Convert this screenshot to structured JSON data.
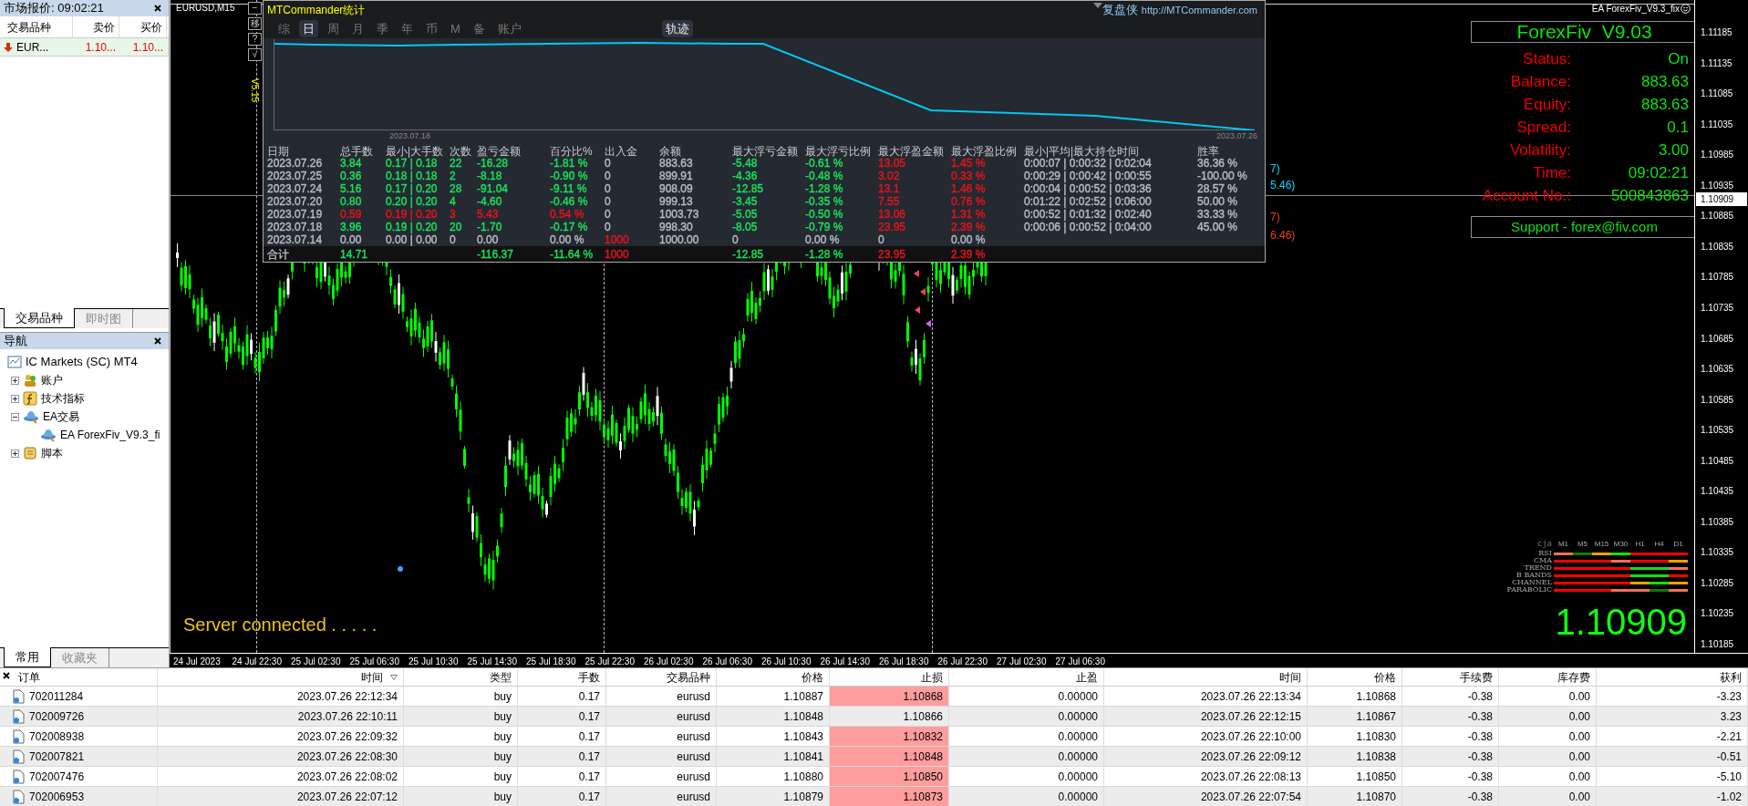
{
  "market_watch": {
    "title": "市场报价: 09:02:21",
    "columns": [
      "交易品种",
      "卖价",
      "买价"
    ],
    "rows": [
      {
        "symbol": "EUR...",
        "bid": "1.10...",
        "ask": "1.10..."
      }
    ],
    "tabs": [
      {
        "label": "交易品种",
        "selected": true
      },
      {
        "label": "即时图",
        "selected": false
      }
    ]
  },
  "navigator": {
    "title": "导航",
    "root": {
      "label": "IC Markets (SC) MT4",
      "children": [
        {
          "label": "账户",
          "kind": "accounts",
          "expanded": false
        },
        {
          "label": "技术指标",
          "kind": "indicators",
          "expanded": false
        },
        {
          "label": "EA交易",
          "kind": "experts",
          "expanded": true,
          "children": [
            {
              "label": "EA ForexFiv_V9.3_fi",
              "kind": "expert"
            }
          ]
        },
        {
          "label": "脚本",
          "kind": "scripts",
          "expanded": false
        }
      ]
    },
    "tabs": [
      {
        "label": "常用",
        "selected": true
      },
      {
        "label": "收藏夹",
        "selected": false
      }
    ]
  },
  "chart": {
    "title": "EURUSD,M15",
    "status": "Server connected . . . . .",
    "current_price": "1.10909",
    "price_labels": [
      "1.11185",
      "1.11135",
      "1.11085",
      "1.11035",
      "1.10985",
      "1.10935",
      "1.10885",
      "1.10835",
      "1.10785",
      "1.10735",
      "1.10685",
      "1.10635",
      "1.10585",
      "1.10535",
      "1.10485",
      "1.10435",
      "1.10385",
      "1.10335",
      "1.10285",
      "1.10235",
      "1.10185"
    ],
    "time_labels": [
      "24 Jul 2023",
      "24 Jul 22:30",
      "25 Jul 02:30",
      "25 Jul 06:30",
      "25 Jul 10:30",
      "25 Jul 14:30",
      "25 Jul 18:30",
      "25 Jul 22:30",
      "26 Jul 02:30",
      "26 Jul 06:30",
      "26 Jul 10:30",
      "26 Jul 14:30",
      "26 Jul 18:30",
      "26 Jul 22:30",
      "27 Jul 02:30",
      "27 Jul 06:30"
    ],
    "line_labels": [
      {
        "text": "7)",
        "color": "#00d8ff"
      },
      {
        "text": "5.46)",
        "color": "#00d8ff"
      },
      {
        "text": "7)",
        "color": "#e8401a"
      },
      {
        "text": "6.46)",
        "color": "#e8401a"
      }
    ]
  },
  "stats_panel": {
    "tool_buttons": [
      "−",
      "移",
      "?",
      "√"
    ],
    "version": "V5.15",
    "title": "MTCommander统计",
    "brand": "复盘侠",
    "url": "http://MTCommander.com",
    "tabs": [
      {
        "label": "综",
        "selected": false
      },
      {
        "label": "日",
        "selected": true
      },
      {
        "label": "周",
        "selected": false
      },
      {
        "label": "月",
        "selected": false
      },
      {
        "label": "季",
        "selected": false
      },
      {
        "label": "年",
        "selected": false
      },
      {
        "label": "币",
        "selected": false
      },
      {
        "label": "M",
        "selected": false
      },
      {
        "label": "备",
        "selected": false
      },
      {
        "label": "账户",
        "selected": false
      }
    ],
    "track_button": {
      "label": "轨迹",
      "selected": true
    },
    "curve_start": "2023.07.18",
    "curve_end": "2023.07.26",
    "columns": [
      "日期",
      "总手数",
      "最小|大手数",
      "次数",
      "盈亏金额",
      "百分比%",
      "出入金",
      "余额",
      "最大浮亏金额",
      "最大浮亏比例",
      "最大浮盈金额",
      "最大浮盈比例",
      "最小|平均|最大持仓时间",
      "胜率"
    ],
    "rows": [
      {
        "total": false,
        "cells": [
          {
            "text": "2023.07.26",
            "color": "#b8bcc4"
          },
          {
            "text": "3.84",
            "color": "#19e35a"
          },
          {
            "text": "0.17 | 0.18",
            "color": "#19e35a"
          },
          {
            "text": "22",
            "color": "#19e35a"
          },
          {
            "text": "-16.28",
            "color": "#19e35a"
          },
          {
            "text": "-1.81 %",
            "color": "#19e35a"
          },
          {
            "text": "0",
            "color": "#b8bcc4"
          },
          {
            "text": "883.63",
            "color": "#b8bcc4"
          },
          {
            "text": "-5.48",
            "color": "#19e35a"
          },
          {
            "text": "-0.61 %",
            "color": "#19e35a"
          },
          {
            "text": "13.05",
            "color": "#e8141c"
          },
          {
            "text": "1.45 %",
            "color": "#e8141c"
          },
          {
            "text": "0:00:07 | 0:00:32 | 0:02:04",
            "color": "#b8bcc4"
          },
          {
            "text": "36.36 %",
            "color": "#b8bcc4"
          }
        ]
      },
      {
        "total": false,
        "cells": [
          {
            "text": "2023.07.25",
            "color": "#b8bcc4"
          },
          {
            "text": "0.36",
            "color": "#19e35a"
          },
          {
            "text": "0.18 | 0.18",
            "color": "#19e35a"
          },
          {
            "text": "2",
            "color": "#19e35a"
          },
          {
            "text": "-8.18",
            "color": "#19e35a"
          },
          {
            "text": "-0.90 %",
            "color": "#19e35a"
          },
          {
            "text": "0",
            "color": "#b8bcc4"
          },
          {
            "text": "899.91",
            "color": "#b8bcc4"
          },
          {
            "text": "-4.36",
            "color": "#19e35a"
          },
          {
            "text": "-0.48 %",
            "color": "#19e35a"
          },
          {
            "text": "3.02",
            "color": "#e8141c"
          },
          {
            "text": "0.33 %",
            "color": "#e8141c"
          },
          {
            "text": "0:00:29 | 0:00:42 | 0:00:55",
            "color": "#b8bcc4"
          },
          {
            "text": "-100.00 %",
            "color": "#b8bcc4"
          }
        ]
      },
      {
        "total": false,
        "cells": [
          {
            "text": "2023.07.24",
            "color": "#b8bcc4"
          },
          {
            "text": "5.16",
            "color": "#19e35a"
          },
          {
            "text": "0.17 | 0.20",
            "color": "#19e35a"
          },
          {
            "text": "28",
            "color": "#19e35a"
          },
          {
            "text": "-91.04",
            "color": "#19e35a"
          },
          {
            "text": "-9.11 %",
            "color": "#19e35a"
          },
          {
            "text": "0",
            "color": "#b8bcc4"
          },
          {
            "text": "908.09",
            "color": "#b8bcc4"
          },
          {
            "text": "-12.85",
            "color": "#19e35a"
          },
          {
            "text": "-1.28 %",
            "color": "#19e35a"
          },
          {
            "text": "13.1",
            "color": "#e8141c"
          },
          {
            "text": "1.46 %",
            "color": "#e8141c"
          },
          {
            "text": "0:00:04 | 0:00:52 | 0:03:36",
            "color": "#b8bcc4"
          },
          {
            "text": "28.57 %",
            "color": "#b8bcc4"
          }
        ]
      },
      {
        "total": false,
        "cells": [
          {
            "text": "2023.07.20",
            "color": "#b8bcc4"
          },
          {
            "text": "0.80",
            "color": "#19e35a"
          },
          {
            "text": "0.20 | 0.20",
            "color": "#19e35a"
          },
          {
            "text": "4",
            "color": "#19e35a"
          },
          {
            "text": "-4.60",
            "color": "#19e35a"
          },
          {
            "text": "-0.46 %",
            "color": "#19e35a"
          },
          {
            "text": "0",
            "color": "#b8bcc4"
          },
          {
            "text": "999.13",
            "color": "#b8bcc4"
          },
          {
            "text": "-3.45",
            "color": "#19e35a"
          },
          {
            "text": "-0.35 %",
            "color": "#19e35a"
          },
          {
            "text": "7.55",
            "color": "#e8141c"
          },
          {
            "text": "0.76 %",
            "color": "#e8141c"
          },
          {
            "text": "0:01:22 | 0:02:52 | 0:06:00",
            "color": "#b8bcc4"
          },
          {
            "text": "50.00 %",
            "color": "#b8bcc4"
          }
        ]
      },
      {
        "total": false,
        "cells": [
          {
            "text": "2023.07.19",
            "color": "#b8bcc4"
          },
          {
            "text": "0.59",
            "color": "#e8141c"
          },
          {
            "text": "0.19 | 0.20",
            "color": "#e8141c"
          },
          {
            "text": "3",
            "color": "#e8141c"
          },
          {
            "text": "5.43",
            "color": "#e8141c"
          },
          {
            "text": "0.54 %",
            "color": "#e8141c"
          },
          {
            "text": "0",
            "color": "#b8bcc4"
          },
          {
            "text": "1003.73",
            "color": "#b8bcc4"
          },
          {
            "text": "-5.05",
            "color": "#19e35a"
          },
          {
            "text": "-0.50 %",
            "color": "#19e35a"
          },
          {
            "text": "13.06",
            "color": "#e8141c"
          },
          {
            "text": "1.31 %",
            "color": "#e8141c"
          },
          {
            "text": "0:00:52 | 0:01:32 | 0:02:40",
            "color": "#b8bcc4"
          },
          {
            "text": "33.33 %",
            "color": "#b8bcc4"
          }
        ]
      },
      {
        "total": false,
        "cells": [
          {
            "text": "2023.07.18",
            "color": "#b8bcc4"
          },
          {
            "text": "3.96",
            "color": "#19e35a"
          },
          {
            "text": "0.19 | 0.20",
            "color": "#19e35a"
          },
          {
            "text": "20",
            "color": "#19e35a"
          },
          {
            "text": "-1.70",
            "color": "#19e35a"
          },
          {
            "text": "-0.17 %",
            "color": "#19e35a"
          },
          {
            "text": "0",
            "color": "#b8bcc4"
          },
          {
            "text": "998.30",
            "color": "#b8bcc4"
          },
          {
            "text": "-8.05",
            "color": "#19e35a"
          },
          {
            "text": "-0.79 %",
            "color": "#19e35a"
          },
          {
            "text": "23.95",
            "color": "#e8141c"
          },
          {
            "text": "2.39 %",
            "color": "#e8141c"
          },
          {
            "text": "0:00:06 | 0:00:52 | 0:04:00",
            "color": "#b8bcc4"
          },
          {
            "text": "45.00 %",
            "color": "#b8bcc4"
          }
        ]
      },
      {
        "total": false,
        "cells": [
          {
            "text": "2023.07.14",
            "color": "#b8bcc4"
          },
          {
            "text": "0.00",
            "color": "#b8bcc4"
          },
          {
            "text": "0.00 | 0.00",
            "color": "#b8bcc4"
          },
          {
            "text": "0",
            "color": "#b8bcc4"
          },
          {
            "text": "0.00",
            "color": "#b8bcc4"
          },
          {
            "text": "0.00 %",
            "color": "#b8bcc4"
          },
          {
            "text": "1000",
            "color": "#e8141c"
          },
          {
            "text": "1000.00",
            "color": "#b8bcc4"
          },
          {
            "text": "0",
            "color": "#b8bcc4"
          },
          {
            "text": "0.00 %",
            "color": "#b8bcc4"
          },
          {
            "text": "0",
            "color": "#b8bcc4"
          },
          {
            "text": "0.00 %",
            "color": "#b8bcc4"
          },
          null,
          null
        ]
      },
      {
        "total": true,
        "cells": [
          {
            "text": "合计",
            "color": "#b8bcc4"
          },
          {
            "text": "14.71",
            "color": "#19e35a"
          },
          null,
          null,
          {
            "text": "-116.37",
            "color": "#19e35a"
          },
          {
            "text": "-11.64 %",
            "color": "#19e35a"
          },
          {
            "text": "1000",
            "color": "#e8141c"
          },
          null,
          {
            "text": "-12.85",
            "color": "#19e35a"
          },
          {
            "text": "-1.28 %",
            "color": "#19e35a"
          },
          {
            "text": "23.95",
            "color": "#e8141c"
          },
          {
            "text": "2.39 %",
            "color": "#e8141c"
          },
          null,
          null
        ]
      }
    ]
  },
  "ea_panel": {
    "header": "EA ForexFiv_V9.3_fix",
    "title": "ForexFiv  V9.03",
    "fields": [
      {
        "label": "Status:",
        "value": "On"
      },
      {
        "label": "Balance:",
        "value": "883.63"
      },
      {
        "label": "Equity:",
        "value": "883.63"
      },
      {
        "label": "Spread:",
        "value": "0.1"
      },
      {
        "label": "Volatility:",
        "value": "3.00"
      },
      {
        "label": "Time:",
        "value": "09:02:21"
      },
      {
        "label": "Account No.:",
        "value": "500843863"
      }
    ],
    "support": "Support - forex@fiv.com"
  },
  "signal_matrix": {
    "corner": "cja",
    "timeframes": [
      "M1",
      "M5",
      "M15",
      "M30",
      "H1",
      "H4",
      "D1"
    ],
    "rows": [
      {
        "label": "RSI",
        "segments": [
          {
            "color": "#f0705a"
          },
          {
            "color": "#0a7a0a"
          },
          {
            "color": "#f5a000"
          },
          {
            "color": "#10e010"
          },
          {
            "color": "#ff0000"
          },
          {
            "color": "#ff0000"
          },
          {
            "color": "#ff0000"
          }
        ]
      },
      {
        "label": "CMA",
        "segments": [
          {
            "color": "#ff0000"
          },
          {
            "color": "#ff0000"
          },
          {
            "color": "#ff0000"
          },
          {
            "color": "#f0705a"
          },
          {
            "color": "#ff0000"
          },
          {
            "color": "#ff0000"
          },
          {
            "color": "#f5a000"
          }
        ]
      },
      {
        "label": "TREND",
        "segments": [
          {
            "color": "#ff0000"
          },
          {
            "color": "#ff0000"
          },
          {
            "color": "#ff0000"
          },
          {
            "color": "#ff0000"
          },
          {
            "color": "#10e010"
          },
          {
            "color": "#10e010"
          },
          {
            "color": "#f0705a"
          }
        ]
      },
      {
        "label": "B BANDS",
        "segments": [
          {
            "color": "#ff0000"
          },
          {
            "color": "#ff0000"
          },
          {
            "color": "#ff0000"
          },
          {
            "color": "#ff0000"
          },
          {
            "color": "#10e010"
          },
          {
            "color": "#10e010"
          },
          {
            "color": "#ff0000"
          }
        ]
      },
      {
        "label": "CHANNEL",
        "segments": [
          {
            "color": "#ff0000"
          },
          {
            "color": "#ff0000"
          },
          {
            "color": "#ff0000"
          },
          {
            "color": "#ff0000"
          },
          {
            "color": "#f5a000"
          },
          {
            "color": "#10e010"
          },
          {
            "color": "#f5a000"
          }
        ]
      },
      {
        "label": "PARABOLIC",
        "segments": [
          {
            "color": "#ff0000"
          },
          {
            "color": "#ff0000"
          },
          {
            "color": "#ff0000"
          },
          {
            "color": "#f0705a"
          },
          {
            "color": "#f0705a"
          },
          {
            "color": "#0a7a0a"
          },
          {
            "color": "#f0705a"
          }
        ]
      }
    ],
    "price": "1.10909"
  },
  "orders": {
    "columns": [
      {
        "label": "订单",
        "sorted": false
      },
      {
        "label": "时间",
        "sorted": true
      },
      {
        "label": "类型",
        "sorted": false
      },
      {
        "label": "手数",
        "sorted": false
      },
      {
        "label": "交易品种",
        "sorted": false
      },
      {
        "label": "价格",
        "sorted": false
      },
      {
        "label": "止损",
        "sorted": false
      },
      {
        "label": "止盈",
        "sorted": false
      },
      {
        "label": "时间",
        "sorted": false
      },
      {
        "label": "价格",
        "sorted": false
      },
      {
        "label": "手续费",
        "sorted": false
      },
      {
        "label": "库存费",
        "sorted": false
      },
      {
        "label": "获利",
        "sorted": false
      }
    ],
    "rows": [
      {
        "order": "702011284",
        "open_time": "2023.07.26 22:12:34",
        "type": "buy",
        "lots": "0.17",
        "symbol": "eurusd",
        "open_price": "1.10887",
        "sl": "1.10868",
        "sl_hit": true,
        "tp": "0.00000",
        "close_time": "2023.07.26 22:13:34",
        "close_price": "1.10868",
        "commission": "-0.38",
        "swap": "0.00",
        "profit": "-3.23"
      },
      {
        "order": "702009726",
        "open_time": "2023.07.26 22:10:11",
        "type": "buy",
        "lots": "0.17",
        "symbol": "eurusd",
        "open_price": "1.10848",
        "sl": "1.10866",
        "sl_hit": false,
        "tp": "0.00000",
        "close_time": "2023.07.26 22:12:15",
        "close_price": "1.10867",
        "commission": "-0.38",
        "swap": "0.00",
        "profit": "3.23"
      },
      {
        "order": "702008938",
        "open_time": "2023.07.26 22:09:32",
        "type": "buy",
        "lots": "0.17",
        "symbol": "eurusd",
        "open_price": "1.10843",
        "sl": "1.10832",
        "sl_hit": true,
        "tp": "0.00000",
        "close_time": "2023.07.26 22:10:00",
        "close_price": "1.10830",
        "commission": "-0.38",
        "swap": "0.00",
        "profit": "-2.21"
      },
      {
        "order": "702007821",
        "open_time": "2023.07.26 22:08:30",
        "type": "buy",
        "lots": "0.17",
        "symbol": "eurusd",
        "open_price": "1.10841",
        "sl": "1.10848",
        "sl_hit": true,
        "tp": "0.00000",
        "close_time": "2023.07.26 22:09:12",
        "close_price": "1.10838",
        "commission": "-0.38",
        "swap": "0.00",
        "profit": "-0.51"
      },
      {
        "order": "702007476",
        "open_time": "2023.07.26 22:08:02",
        "type": "buy",
        "lots": "0.17",
        "symbol": "eurusd",
        "open_price": "1.10880",
        "sl": "1.10850",
        "sl_hit": true,
        "tp": "0.00000",
        "close_time": "2023.07.26 22:08:13",
        "close_price": "1.10850",
        "commission": "-0.38",
        "swap": "0.00",
        "profit": "-5.10"
      },
      {
        "order": "702006953",
        "open_time": "2023.07.26 22:07:12",
        "type": "buy",
        "lots": "0.17",
        "symbol": "eurusd",
        "open_price": "1.10879",
        "sl": "1.10873",
        "sl_hit": true,
        "tp": "0.00000",
        "close_time": "2023.07.26 22:07:54",
        "close_price": "1.10870",
        "commission": "-0.38",
        "swap": "0.00",
        "profit": "-1.02"
      }
    ]
  }
}
